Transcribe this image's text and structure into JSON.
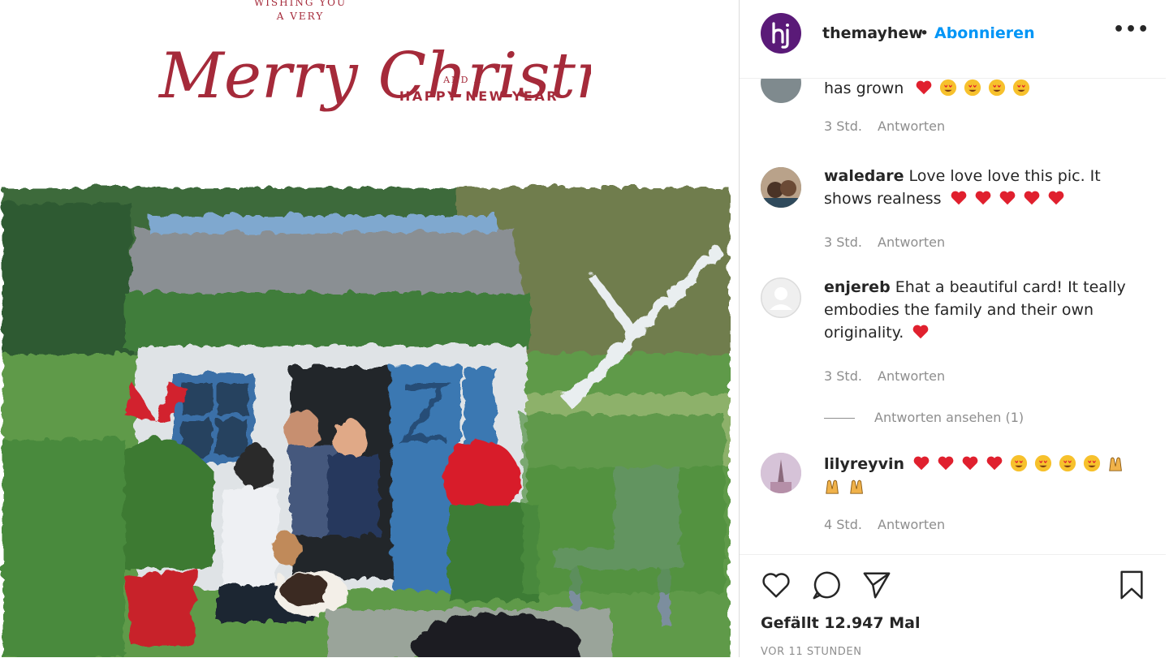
{
  "card": {
    "greeting_line1": "WISHING YOU",
    "greeting_line2": "A VERY",
    "greeting_main": "Merry Christmas",
    "greeting_and": "AND A",
    "greeting_newyear": "HAPPY NEW YEAR"
  },
  "header": {
    "username": "themayhew",
    "separator": "•",
    "follow_label": "Abonnieren",
    "more_label": "•••",
    "avatar_letters": "hj"
  },
  "comments": [
    {
      "username": "",
      "text": "has grown",
      "emojis": [
        "heart",
        "heart-eyes",
        "heart-eyes",
        "heart-eyes",
        "heart-eyes"
      ],
      "time": "3 Std.",
      "reply_label": "Antworten"
    },
    {
      "username": "waledare",
      "text": "Love love love this pic. It shows realness",
      "emojis": [
        "heart",
        "heart",
        "heart",
        "heart",
        "heart"
      ],
      "time": "3 Std.",
      "reply_label": "Antworten"
    },
    {
      "username": "enjereb",
      "text": "Ehat a beautiful card! It teally embodies the family and their own originality.",
      "emojis": [
        "heart"
      ],
      "time": "3 Std.",
      "reply_label": "Antworten",
      "view_replies": "Antworten ansehen (1)"
    },
    {
      "username": "lilyreyvin",
      "text": "",
      "emojis": [
        "heart",
        "heart",
        "heart",
        "heart",
        "heart-eyes",
        "heart-eyes",
        "heart-eyes",
        "heart-eyes",
        "hands-up",
        "hands-up",
        "hands-up"
      ],
      "time": "4 Std.",
      "reply_label": "Antworten"
    }
  ],
  "actions": {
    "like_icon": "heart-outline-icon",
    "comment_icon": "comment-icon",
    "share_icon": "paper-plane-icon",
    "save_icon": "bookmark-icon",
    "likes_text": "Gefällt 12.947 Mal",
    "time_ago": "VOR 11 STUNDEN"
  },
  "colors": {
    "accent_blue": "#0095f6",
    "card_red": "#a52a3a",
    "heart_red": "#e0202e"
  }
}
